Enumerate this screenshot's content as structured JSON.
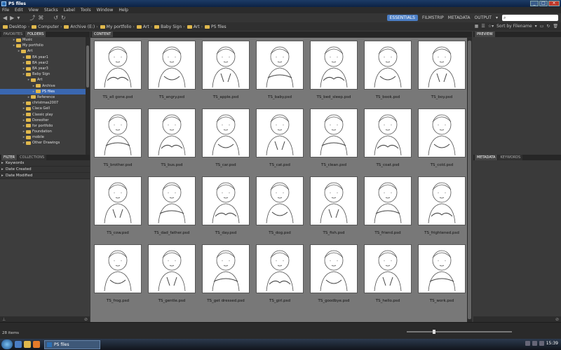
{
  "window": {
    "title": "PS files"
  },
  "menu": [
    "File",
    "Edit",
    "View",
    "Stacks",
    "Label",
    "Tools",
    "Window",
    "Help"
  ],
  "workspaces": {
    "items": [
      "ESSENTIALS",
      "FILMSTRIP",
      "METADATA",
      "OUTPUT"
    ],
    "active": "ESSENTIALS"
  },
  "path": [
    "Desktop",
    "Computer",
    "Archive (E:)",
    "My portfolio",
    "Art",
    "Baby Sign",
    "Art",
    "PS files"
  ],
  "sort_label": "Sort by Filename",
  "left_tabs": [
    "FAVORITES",
    "FOLDERS"
  ],
  "folders": [
    {
      "label": "Music",
      "level": 1
    },
    {
      "label": "My portfolio",
      "level": 1
    },
    {
      "label": "Art",
      "level": 2
    },
    {
      "label": "BA year1",
      "level": 3
    },
    {
      "label": "BA year2",
      "level": 3
    },
    {
      "label": "BA year3",
      "level": 3
    },
    {
      "label": "Baby Sign",
      "level": 3
    },
    {
      "label": "Art",
      "level": 4
    },
    {
      "label": "Archive",
      "level": 5
    },
    {
      "label": "PS files",
      "level": 5,
      "selected": true
    },
    {
      "label": "Reference",
      "level": 4
    },
    {
      "label": "christmas2007",
      "level": 3
    },
    {
      "label": "Claca Gell",
      "level": 3
    },
    {
      "label": "Classic play",
      "level": 3
    },
    {
      "label": "Doreolter",
      "level": 3
    },
    {
      "label": "for portfolio",
      "level": 3
    },
    {
      "label": "Foundation",
      "level": 3
    },
    {
      "label": "mobile",
      "level": 3
    },
    {
      "label": "Other Drawings",
      "level": 3
    }
  ],
  "filter_tabs": [
    "FILTER",
    "COLLECTIONS"
  ],
  "filters": [
    "Keywords",
    "Date Created",
    "Date Modified"
  ],
  "content_tab": "CONTENT",
  "files": [
    "TS_all gone.psd",
    "TS_angry.psd",
    "TS_apple.psd",
    "TS_baby.psd",
    "TS_bed_sleep.psd",
    "TS_book.psd",
    "TS_boy.psd",
    "TS_brother.psd",
    "TS_bus.psd",
    "TS_car.psd",
    "TS_cat.psd",
    "TS_clean.psd",
    "TS_coat.psd",
    "TS_cold.psd",
    "TS_cow.psd",
    "TS_dad_father.psd",
    "TS_day.psd",
    "TS_dog.psd",
    "TS_fish.psd",
    "TS_friend.psd",
    "TS_frightened.psd",
    "TS_frog.psd",
    "TS_gentle.psd",
    "TS_get dressed.psd",
    "TS_girl.psd",
    "TS_goodbye.psd",
    "TS_hello.psd",
    "TS_work.psd"
  ],
  "right_tabs": {
    "top": [
      "PREVIEW"
    ],
    "bottom": [
      "METADATA",
      "KEYWORDS"
    ]
  },
  "status": {
    "item_count": "28 items",
    "thumb_size": 0.25
  },
  "taskbar": {
    "task_label": "PS files",
    "clock": "15:39"
  }
}
